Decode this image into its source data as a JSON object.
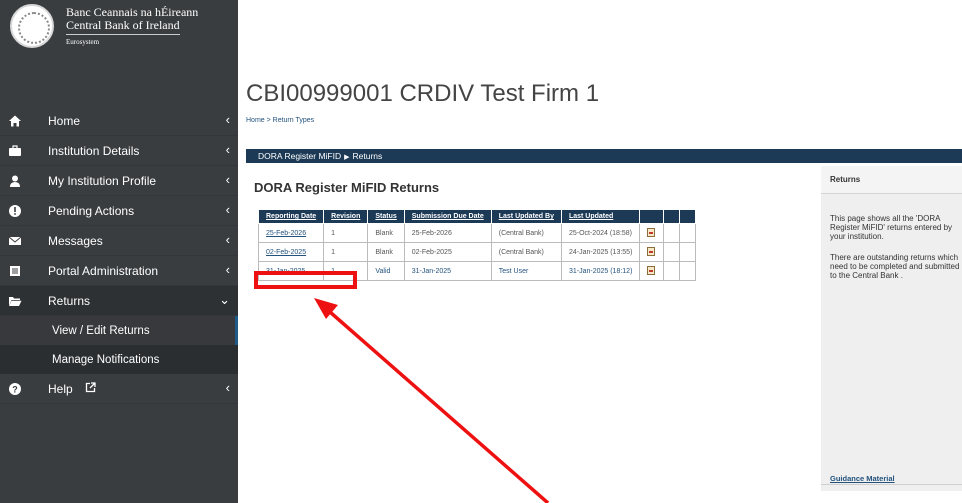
{
  "logo": {
    "line1": "Banc Ceannais na hÉireann",
    "line2": "Central Bank of Ireland",
    "line3": "Eurosystem"
  },
  "nav": [
    {
      "label": "Home",
      "icon": "home-icon"
    },
    {
      "label": "Institution Details",
      "icon": "briefcase-icon"
    },
    {
      "label": "My Institution Profile",
      "icon": "user-icon"
    },
    {
      "label": "Pending Actions",
      "icon": "alert-icon"
    },
    {
      "label": "Messages",
      "icon": "envelope-icon"
    },
    {
      "label": "Portal Administration",
      "icon": "list-icon"
    },
    {
      "label": "Returns",
      "icon": "folder-open-icon",
      "expanded": true,
      "children": [
        {
          "label": "View / Edit Returns",
          "selected": true
        },
        {
          "label": "Manage Notifications"
        }
      ]
    },
    {
      "label": "Help",
      "icon": "question-icon",
      "external_icon": "external-link-icon"
    }
  ],
  "page": {
    "title": "CBI00999001 CRDIV Test Firm 1",
    "breadcrumb": "Home > Return Types",
    "section_bar": {
      "first": "DORA Register MiFID",
      "second": "Returns"
    },
    "returns_title": "DORA Register MiFID Returns"
  },
  "table": {
    "headers": [
      "Reporting Date",
      "Revision",
      "Status",
      "Submission Due Date",
      "Last Updated By",
      "Last Updated"
    ],
    "rows": [
      {
        "reporting_date": "25-Feb-2026",
        "revision": "1",
        "status": "Blank",
        "due": "25-Feb-2026",
        "updated_by": "(Central Bank)",
        "last_updated": "25-Oct-2024 (18:58)"
      },
      {
        "reporting_date": "02-Feb-2025",
        "revision": "1",
        "status": "Blank",
        "due": "02-Feb-2025",
        "updated_by": "(Central Bank)",
        "last_updated": "24-Jan-2025 (13:55)"
      },
      {
        "reporting_date": "31-Jan-2025",
        "revision": "1",
        "status": "Valid",
        "due": "31-Jan-2025",
        "updated_by": "Test User",
        "last_updated": "31-Jan-2025 (18:12)"
      }
    ]
  },
  "right_panel": {
    "title": "Returns",
    "para1": "This page shows all the 'DORA Register MiFID' returns entered by your institution.",
    "para2": "There are outstanding returns which need to be completed and submitted to the Central Bank .",
    "guidance": "Guidance Material"
  },
  "colors": {
    "sidebar": "#3a3d40",
    "header_bar": "#1c3956",
    "link": "#23527c",
    "annotation": "#ee1111"
  }
}
